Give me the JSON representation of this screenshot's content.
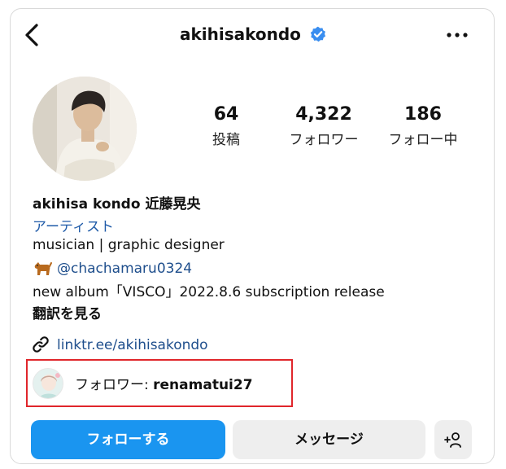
{
  "header": {
    "username": "akihisakondo",
    "verified": true
  },
  "stats": {
    "posts": {
      "count": "64",
      "label": "投稿"
    },
    "followers": {
      "count": "4,322",
      "label": "フォロワー"
    },
    "following": {
      "count": "186",
      "label": "フォロー中"
    }
  },
  "bio": {
    "display_name": "akihisa kondo 近藤晃央",
    "category": "アーティスト",
    "description": "musician | graphic designer",
    "mention": "@chachamaru0324",
    "album_text": "new album「VISCO」2022.8.6 subscription release",
    "translate": "翻訳を見る",
    "link": "linktr.ee/akihisakondo"
  },
  "followed_by": {
    "prefix": "フォロワー: ",
    "name": "renamatui27"
  },
  "actions": {
    "follow": "フォローする",
    "message": "メッセージ"
  },
  "colors": {
    "verified_blue": "#3a8ef0",
    "follow_button": "#1a95f0",
    "link_blue": "#1e4e8c",
    "highlight_red": "#e0262b"
  },
  "icons": {
    "back": "chevron-left-icon",
    "more": "more-horizontal-icon",
    "verified": "verified-badge-icon",
    "link": "link-icon",
    "dog": "dog-emoji-icon",
    "add_user": "add-user-icon"
  }
}
